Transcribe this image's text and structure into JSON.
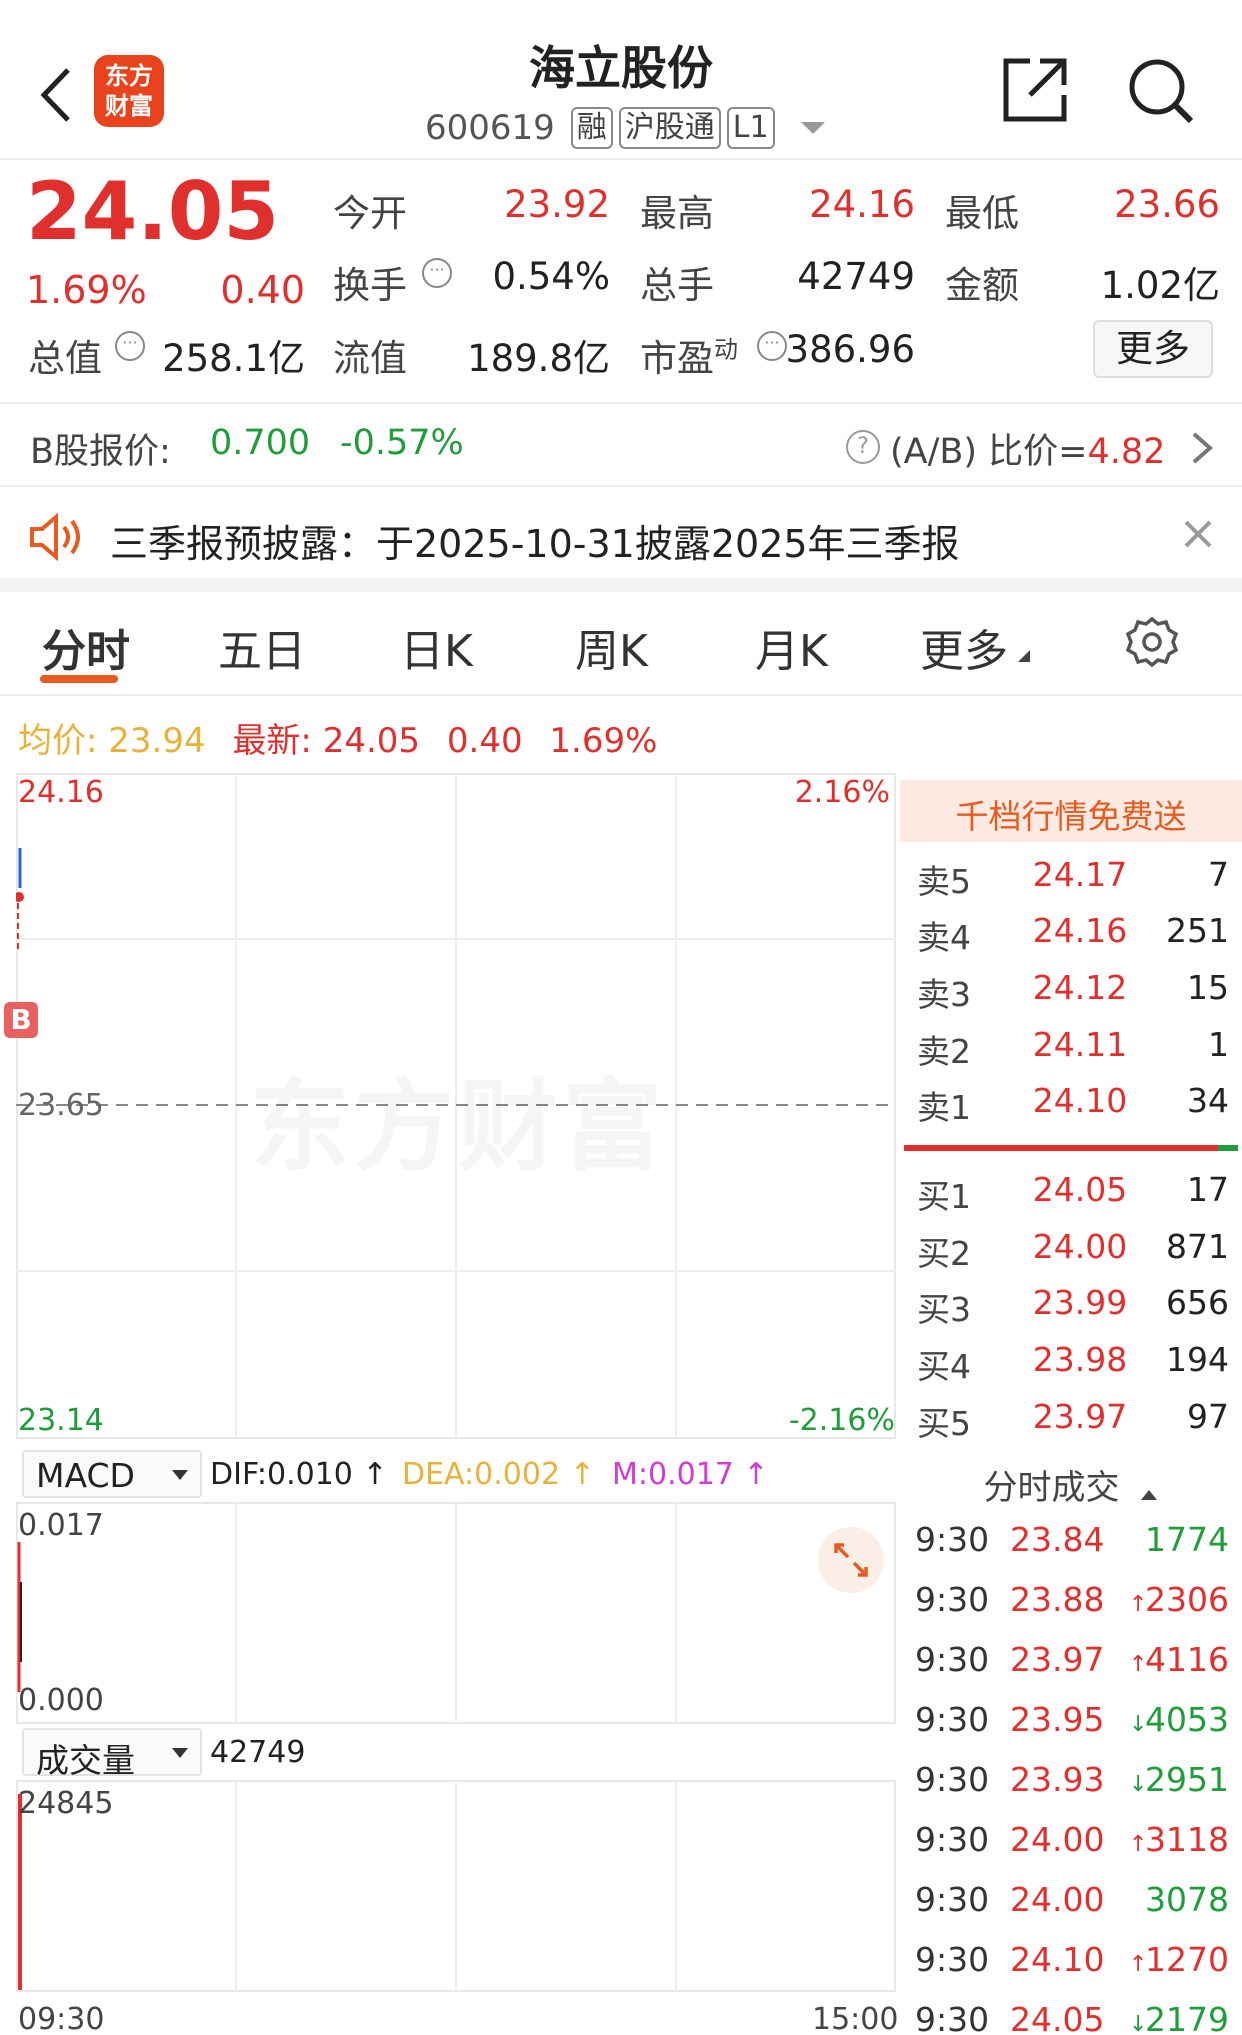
{
  "header": {
    "back_icon": "chevron-left-icon",
    "logo_text_line1": "东方",
    "logo_text_line2": "财富",
    "title": "海立股份",
    "code": "600619",
    "tags": [
      "融",
      "沪股通",
      "L1"
    ],
    "share_icon": "external-link-icon",
    "search_icon": "search-icon"
  },
  "quote": {
    "price": "24.05",
    "change_pct": "1.69%",
    "change": "0.40",
    "open_label": "今开",
    "open": "23.92",
    "high_label": "最高",
    "high": "24.16",
    "low_label": "最低",
    "low": "23.66",
    "turnover_label": "换手",
    "turnover": "0.54%",
    "volume_label": "总手",
    "volume": "42749",
    "amount_label": "金额",
    "amount": "1.02亿",
    "mktcap_label": "总值",
    "mktcap": "258.1亿",
    "float_label": "流值",
    "float": "189.8亿",
    "pe_label": "市盈",
    "pe_sup": "动",
    "pe": "386.96",
    "more_button": "更多"
  },
  "bshare": {
    "label": "B股报价:",
    "price": "0.700",
    "change": "-0.57%",
    "ratio_label": "(A/B) 比价=",
    "ratio": "4.82"
  },
  "notice": {
    "text": "三季报预披露：于2025-10-31披露2025年三季报"
  },
  "tabs": [
    {
      "label": "分时",
      "active": true
    },
    {
      "label": "五日"
    },
    {
      "label": "日K"
    },
    {
      "label": "周K"
    },
    {
      "label": "月K"
    },
    {
      "label": "更多"
    }
  ],
  "summary": {
    "avg_label": "均价:",
    "avg": "23.94",
    "latest_label": "最新:",
    "latest": "24.05",
    "change": "0.40",
    "pct": "1.69%"
  },
  "chart": {
    "y_top": "24.16",
    "y_mid": "23.65",
    "y_bottom": "23.14",
    "pct_top": "2.16%",
    "pct_bottom": "-2.16%",
    "buy_marker": "B",
    "watermark": "东方财富",
    "x_start": "09:30",
    "x_end": "15:00"
  },
  "macd": {
    "selector": "MACD",
    "dif": "DIF:0.010 ↑",
    "dea": "DEA:0.002 ↑",
    "m": "M:0.017 ↑",
    "y_top": "0.017",
    "y_bottom": "0.000"
  },
  "volume_panel": {
    "selector": "成交量",
    "value": "42749",
    "y_top": "24845"
  },
  "orderbook": {
    "banner": "千档行情免费送",
    "asks": [
      {
        "label": "卖5",
        "price": "24.17",
        "vol": "7"
      },
      {
        "label": "卖4",
        "price": "24.16",
        "vol": "251"
      },
      {
        "label": "卖3",
        "price": "24.12",
        "vol": "15"
      },
      {
        "label": "卖2",
        "price": "24.11",
        "vol": "1"
      },
      {
        "label": "卖1",
        "price": "24.10",
        "vol": "34"
      }
    ],
    "bids": [
      {
        "label": "买1",
        "price": "24.05",
        "vol": "17"
      },
      {
        "label": "买2",
        "price": "24.00",
        "vol": "871"
      },
      {
        "label": "买3",
        "price": "23.99",
        "vol": "656"
      },
      {
        "label": "买4",
        "price": "23.98",
        "vol": "194"
      },
      {
        "label": "买5",
        "price": "23.97",
        "vol": "97"
      }
    ],
    "buy_ratio": 0.94
  },
  "trades": {
    "title": "分时成交",
    "rows": [
      {
        "time": "9:30",
        "price": "23.84",
        "arrow": "",
        "vol": "1774",
        "dir": "green"
      },
      {
        "time": "9:30",
        "price": "23.88",
        "arrow": "↑",
        "vol": "2306",
        "dir": "red"
      },
      {
        "time": "9:30",
        "price": "23.97",
        "arrow": "↑",
        "vol": "4116",
        "dir": "red"
      },
      {
        "time": "9:30",
        "price": "23.95",
        "arrow": "↓",
        "vol": "4053",
        "dir": "green"
      },
      {
        "time": "9:30",
        "price": "23.93",
        "arrow": "↓",
        "vol": "2951",
        "dir": "green"
      },
      {
        "time": "9:30",
        "price": "24.00",
        "arrow": "↑",
        "vol": "3118",
        "dir": "red"
      },
      {
        "time": "9:30",
        "price": "24.00",
        "arrow": "",
        "vol": "3078",
        "dir": "green"
      },
      {
        "time": "9:30",
        "price": "24.10",
        "arrow": "↑",
        "vol": "1270",
        "dir": "red"
      },
      {
        "time": "9:30",
        "price": "24.05",
        "arrow": "↓",
        "vol": "2179",
        "dir": "green"
      }
    ]
  },
  "colors": {
    "up": "#e0302e",
    "down": "#1e9d3a",
    "accent": "#e85a1f",
    "avg": "#e8b23a",
    "macd_m": "#d63ad6"
  }
}
